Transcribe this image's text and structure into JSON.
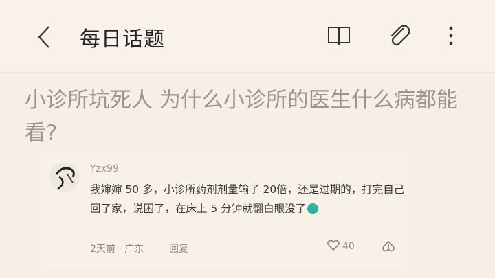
{
  "header": {
    "title": "每日话题",
    "icons": [
      "back-icon",
      "book-icon",
      "paperclip-icon",
      "more-icon"
    ]
  },
  "question": {
    "title": "小诊所坑死人 为什么小诊所的医生什么病都能看?"
  },
  "comment": {
    "username": "Yzx99",
    "text": "我婶婶 50 多，小诊所药剂剂量输了 20倍，还是过期的，打完自己回了家，说困了，在床上 5 分钟就翻白眼没了",
    "emoji": "crying-face",
    "time_location": "2天前 · 广东",
    "reply_label": "回复",
    "like_count": "40"
  },
  "colors": {
    "background": "#f6efe6",
    "question_text": "#9a9590",
    "meta_text": "#8c8782"
  }
}
